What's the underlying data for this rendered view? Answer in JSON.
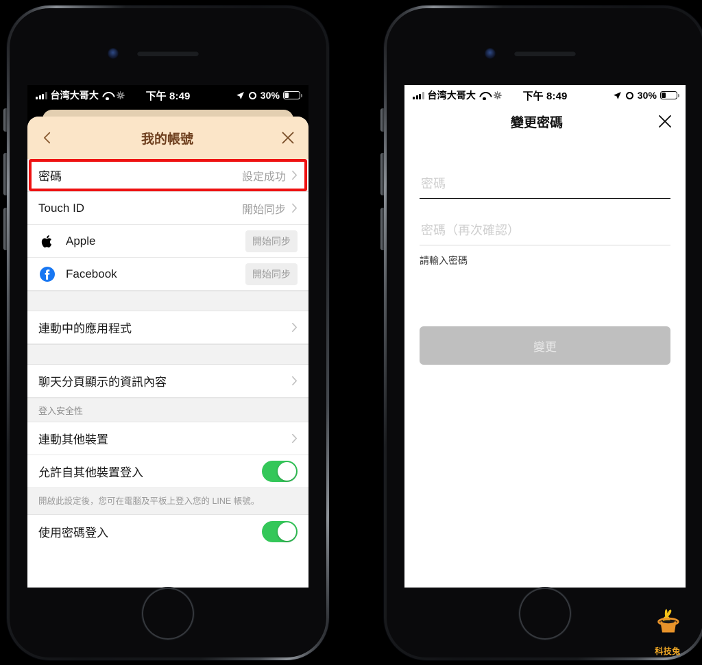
{
  "left_phone": {
    "status_bar": {
      "carrier": "台湾大哥大",
      "time": "下午 8:49",
      "battery_percent": "30%",
      "signal_icon": "cellular-bars-icon",
      "wifi_icon": "wifi-icon",
      "spinner_icon": "activity-spinner-icon",
      "location_icon": "location-arrow-icon",
      "alarm_icon": "alarm-clock-icon",
      "battery_icon": "battery-icon"
    },
    "sheet": {
      "back_icon": "chevron-left-icon",
      "title": "我的帳號",
      "close_icon": "close-x-icon"
    },
    "rows": [
      {
        "label": "密碼",
        "value": "設定成功",
        "accessory": "chevron-right-icon",
        "highlighted": true
      },
      {
        "label": "Touch ID",
        "value": "開始同步",
        "accessory": "chevron-right-icon",
        "highlighted": false
      },
      {
        "label": "Apple",
        "icon": "apple-logo-icon",
        "badge": "開始同步"
      },
      {
        "label": "Facebook",
        "icon": "facebook-logo-icon",
        "badge": "開始同步"
      }
    ],
    "linked_apps": {
      "label": "連動中的應用程式",
      "accessory": "chevron-right-icon"
    },
    "chat_info": {
      "label": "聊天分頁顯示的資訊內容",
      "accessory": "chevron-right-icon"
    },
    "security_section": {
      "header": "登入安全性",
      "link_device": {
        "label": "連動其他裝置",
        "accessory": "chevron-right-icon"
      },
      "allow_login": {
        "label": "允許自其他裝置登入",
        "toggle": "on"
      },
      "note": "開啟此設定後，您可在電腦及平板上登入您的 LINE 帳號。",
      "password_login": {
        "label": "使用密碼登入",
        "toggle": "on"
      }
    },
    "highlight_color": "#ee1111",
    "header_color": "#fbe5c8",
    "toggle_on_color": "#34c759"
  },
  "right_phone": {
    "status_bar": {
      "carrier": "台湾大哥大",
      "time": "下午 8:49",
      "battery_percent": "30%",
      "signal_icon": "cellular-bars-icon",
      "wifi_icon": "wifi-icon",
      "spinner_icon": "activity-spinner-icon",
      "location_icon": "location-arrow-icon",
      "alarm_icon": "alarm-clock-icon",
      "battery_icon": "battery-icon"
    },
    "header": {
      "title": "變更密碼",
      "close_icon": "close-x-icon"
    },
    "password_field": {
      "value": "",
      "placeholder": "密碼"
    },
    "confirm_field": {
      "value": "",
      "placeholder": "密碼（再次確認）"
    },
    "hint": "請輸入密碼",
    "submit_label": "變更"
  },
  "watermark": {
    "label": "科技兔",
    "icon": "rabbit-in-hat-icon",
    "color": "#f0a825"
  }
}
